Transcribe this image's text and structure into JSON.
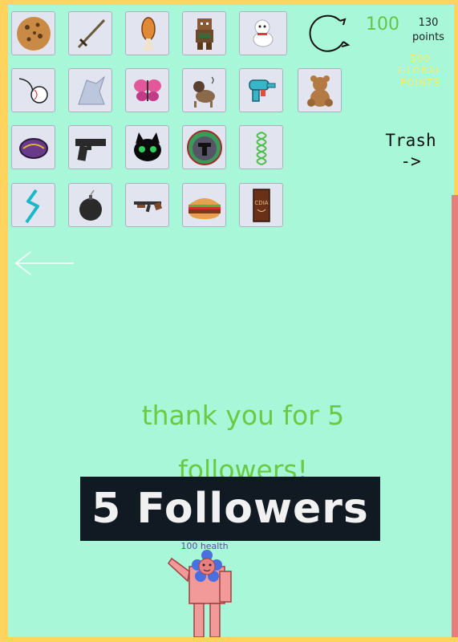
{
  "score": {
    "points_value": "100",
    "points_label": "130 points",
    "global_label": "500 GLOBAL POINTS"
  },
  "trash": {
    "label": "Trash",
    "arrow": "->"
  },
  "inventory": [
    {
      "name": "cookie"
    },
    {
      "name": "sword"
    },
    {
      "name": "drumstick"
    },
    {
      "name": "pixel-character"
    },
    {
      "name": "white-dog"
    },
    {
      "name": "baseball"
    },
    {
      "name": "ghost-figure"
    },
    {
      "name": "butterfly"
    },
    {
      "name": "dog-photo"
    },
    {
      "name": "water-gun"
    },
    {
      "name": "teddy-bear"
    },
    {
      "name": "purple-cookie"
    },
    {
      "name": "pistol"
    },
    {
      "name": "black-cat"
    },
    {
      "name": "armor-badge"
    },
    {
      "name": "green-spring"
    },
    {
      "name": "cyan-zigzag"
    },
    {
      "name": "bomb"
    },
    {
      "name": "rifle"
    },
    {
      "name": "burger"
    },
    {
      "name": "chocolate-bar"
    }
  ],
  "chocolate_text": "CDIA",
  "message": {
    "line1": "thank you for 5",
    "line2": "followers!"
  },
  "banner": {
    "text": "5 Followers"
  },
  "player": {
    "health_text": "100 health"
  },
  "colors": {
    "background": "#a8f7d9",
    "border": "#ffd45e",
    "accent_green": "#6cc943",
    "right_bar": "#e97d7d"
  }
}
